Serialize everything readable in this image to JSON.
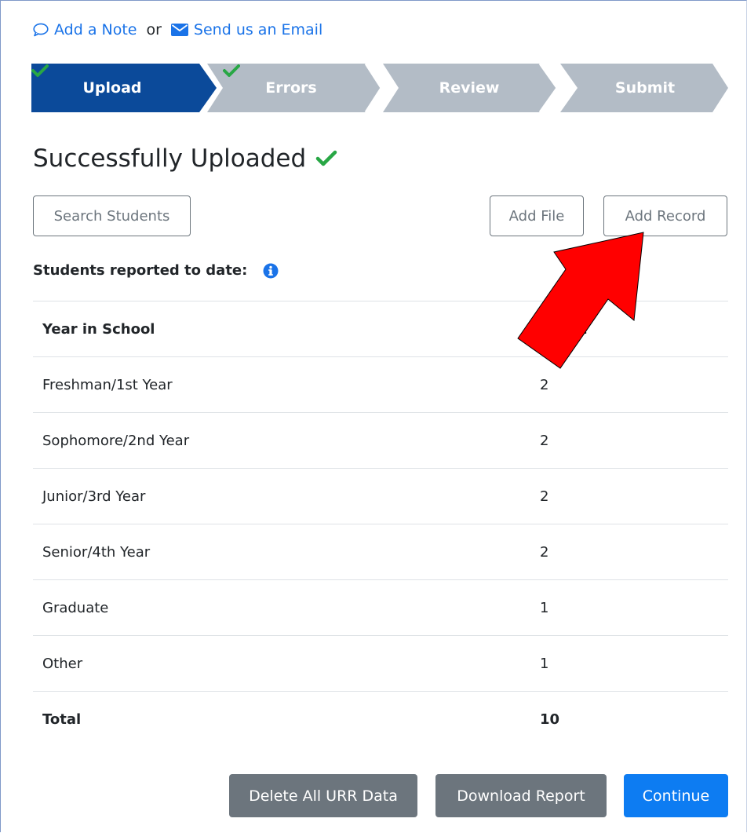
{
  "contact": {
    "note_label": "Add a Note",
    "or_label": "or",
    "email_label": "Send us an Email"
  },
  "steps": [
    {
      "label": "Upload",
      "status": "complete",
      "current": true
    },
    {
      "label": "Errors",
      "status": "complete",
      "current": false
    },
    {
      "label": "Review",
      "status": "pending",
      "current": false
    },
    {
      "label": "Submit",
      "status": "pending",
      "current": false
    }
  ],
  "page_title": "Successfully Uploaded",
  "search": {
    "placeholder": "Search Students"
  },
  "toolbar": {
    "add_file_label": "Add File",
    "add_record_label": "Add Record"
  },
  "reported_label": "Students reported to date:",
  "table": {
    "columns": [
      "Year in School",
      "Count"
    ],
    "rows": [
      {
        "year": "Freshman/1st Year",
        "count": "2"
      },
      {
        "year": "Sophomore/2nd Year",
        "count": "2"
      },
      {
        "year": "Junior/3rd Year",
        "count": "2"
      },
      {
        "year": "Senior/4th Year",
        "count": "2"
      },
      {
        "year": "Graduate",
        "count": "1"
      },
      {
        "year": "Other",
        "count": "1"
      }
    ],
    "total": {
      "label": "Total",
      "count": "10"
    }
  },
  "actions": {
    "delete_label": "Delete All URR Data",
    "download_label": "Download Report",
    "continue_label": "Continue"
  },
  "colors": {
    "step_active": "#0b4a9a",
    "step_inactive": "#b3bcc6",
    "check_green": "#28a745",
    "link_blue": "#1a73e8",
    "primary": "#0d7cf2",
    "secondary": "#6c757d",
    "annotation_arrow": "#ff0000"
  },
  "icons": {
    "note": "speech-bubble-icon",
    "email": "envelope-icon",
    "check": "check-icon",
    "info": "info-circle-icon",
    "annotation": "red-arrow-annotation"
  }
}
